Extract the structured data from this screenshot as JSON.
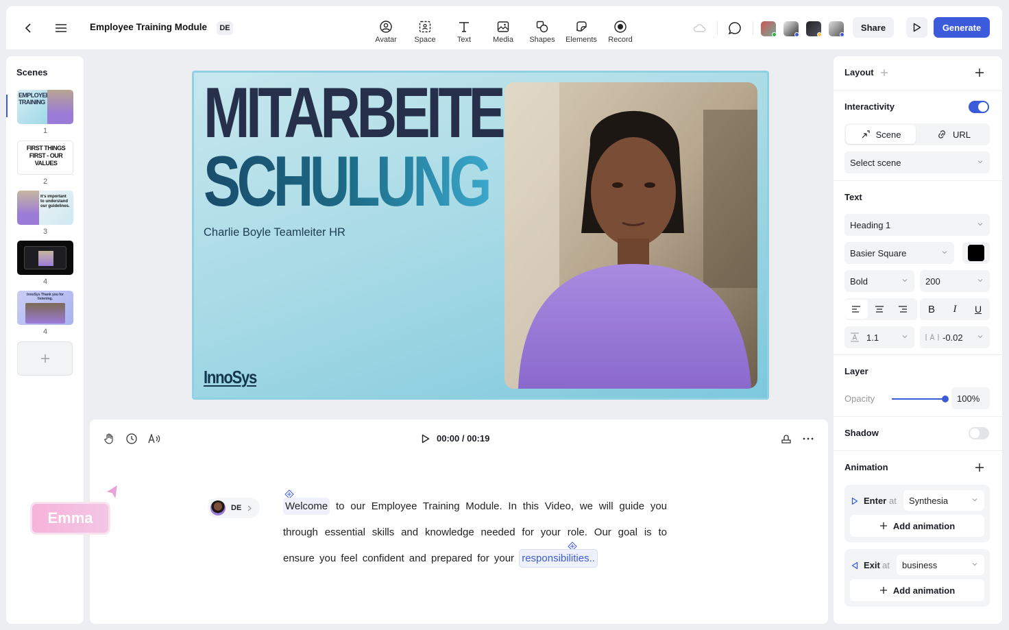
{
  "header": {
    "title": "Employee Training Module",
    "lang": "DE",
    "tools": [
      {
        "label": "Avatar",
        "icon": "avatar-icon"
      },
      {
        "label": "Space",
        "icon": "space-icon"
      },
      {
        "label": "Text",
        "icon": "text-icon"
      },
      {
        "label": "Media",
        "icon": "media-icon"
      },
      {
        "label": "Shapes",
        "icon": "shapes-icon"
      },
      {
        "label": "Elements",
        "icon": "elements-icon"
      },
      {
        "label": "Record",
        "icon": "record-icon"
      }
    ],
    "share_label": "Share",
    "generate_label": "Generate"
  },
  "scenes": {
    "title": "Scenes",
    "items": [
      {
        "num": "1",
        "text": "EMPLOYEE TRAINING"
      },
      {
        "num": "2",
        "text": "FIRST THINGS FIRST - OUR VALUES"
      },
      {
        "num": "3",
        "text": "It's important to understand our guidelines."
      },
      {
        "num": "4",
        "text": ""
      },
      {
        "num": "4",
        "text": "InnoSys Thank you for listening."
      }
    ]
  },
  "canvas": {
    "headline_1": "MITARBEITER-",
    "headline_2": "SCHULUNG",
    "subtitle": "Charlie Boyle Teamleiter HR",
    "brand": "InnoSys"
  },
  "timeline": {
    "time": "00:00 / 00:19",
    "speaker_lang": "DE",
    "speaker_name": "Emma",
    "script_first": "Welcome",
    "script_body": "to our Employee Training Module. In this Video, we will guide you through essential skills and knowledge needed for your role. Our goal is to ensure you feel confident and prepared for your",
    "script_last": "responsibilities.."
  },
  "props": {
    "layout_title": "Layout",
    "interactivity_title": "Interactivity",
    "interactivity_on": true,
    "seg_scene": "Scene",
    "seg_url": "URL",
    "select_scene": "Select scene",
    "text_title": "Text",
    "heading": "Heading 1",
    "font": "Basier Square",
    "text_color": "#000000",
    "weight": "Bold",
    "size": "200",
    "line_height": "1.1",
    "letter_spacing": "-0.02",
    "layer_title": "Layer",
    "opacity_label": "Opacity",
    "opacity_value": "100%",
    "opacity_level": 1.0,
    "shadow_title": "Shadow",
    "shadow_on": false,
    "animation_title": "Animation",
    "enter_label": "Enter",
    "enter_at": "at",
    "enter_value": "Synthesia",
    "exit_label": "Exit",
    "exit_at": "at",
    "exit_value": "business",
    "add_animation": "Add animation"
  },
  "colors": {
    "accent": "#3b5bdb",
    "headline_dark": "#27304a",
    "headline_teal": "#1c6a86"
  }
}
